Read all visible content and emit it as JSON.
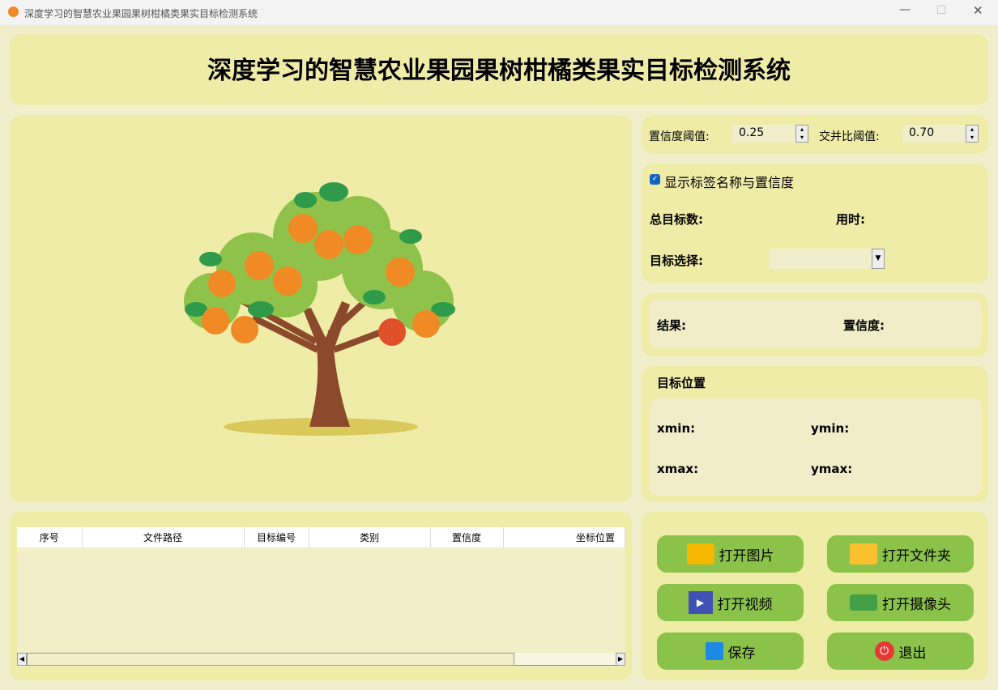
{
  "window": {
    "title": "深度学习的智慧农业果园果树柑橘类果实目标检测系统"
  },
  "header": {
    "title": "深度学习的智慧农业果园果树柑橘类果实目标检测系统"
  },
  "params": {
    "conf_label": "置信度阈值:",
    "conf_value": "0.25",
    "iou_label": "交并比阈值:",
    "iou_value": "0.70"
  },
  "options": {
    "show_labels": "显示标签名称与置信度",
    "show_labels_checked": true,
    "total_label": "总目标数:",
    "time_label": "用时:",
    "select_label": "目标选择:"
  },
  "result": {
    "result_label": "结果:",
    "conf_label": "置信度:"
  },
  "position": {
    "title": "目标位置",
    "xmin": "xmin:",
    "ymin": "ymin:",
    "xmax": "xmax:",
    "ymax": "ymax:"
  },
  "table": {
    "columns": [
      "序号",
      "文件路径",
      "目标编号",
      "类别",
      "置信度",
      "坐标位置"
    ]
  },
  "buttons": {
    "open_image": "打开图片",
    "open_folder": "打开文件夹",
    "open_video": "打开视频",
    "open_camera": "打开摄像头",
    "save": "保存",
    "exit": "退出"
  }
}
